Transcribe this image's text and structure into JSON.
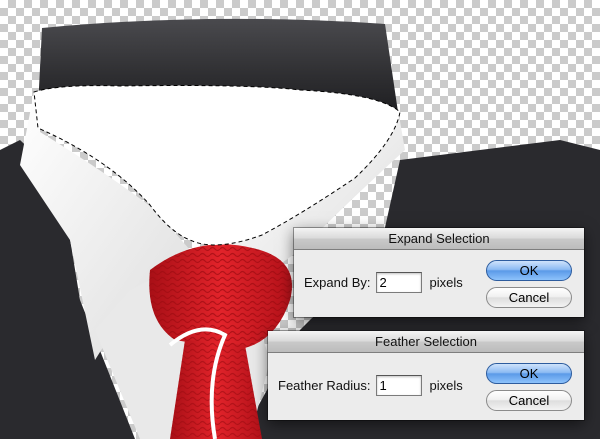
{
  "expand_dialog": {
    "title": "Expand Selection",
    "field_label": "Expand By:",
    "value": "2",
    "unit": "pixels",
    "ok_label": "OK",
    "cancel_label": "Cancel"
  },
  "feather_dialog": {
    "title": "Feather Selection",
    "field_label": "Feather Radius:",
    "value": "1",
    "unit": "pixels",
    "ok_label": "OK",
    "cancel_label": "Cancel"
  },
  "colors": {
    "jacket": "#2a2a2e",
    "collar_band": "#333336",
    "shirt": "#f2f2f2",
    "tie": "#d61f26",
    "transparency_checker": "#cbcbcb"
  }
}
